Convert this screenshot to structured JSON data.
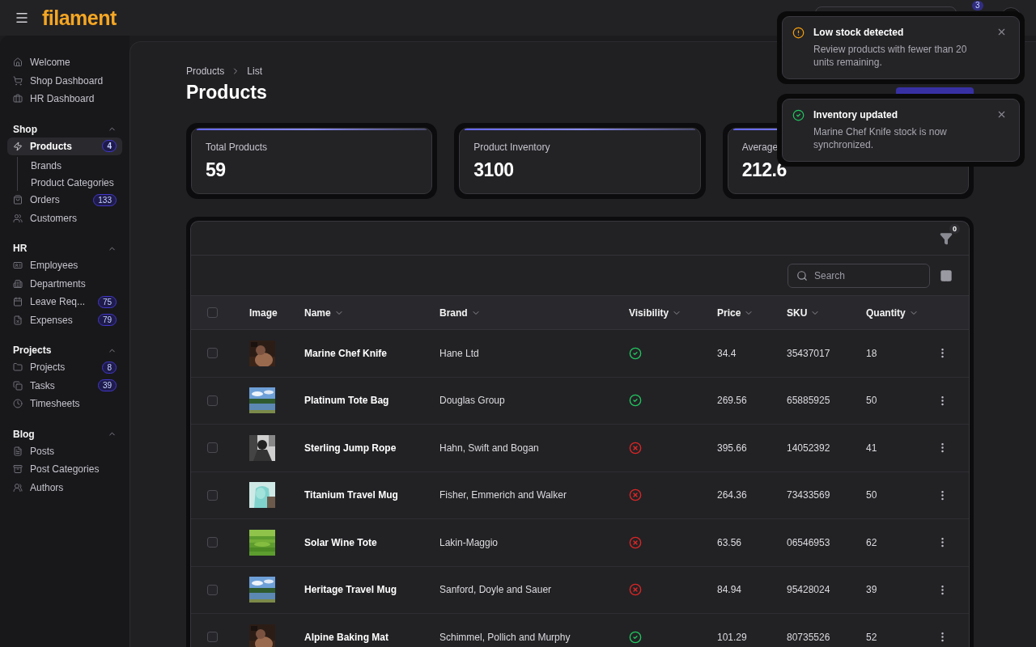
{
  "topbar": {
    "brand": "filament",
    "notification_count": "3"
  },
  "sidebar": {
    "groups": [
      {
        "items": [
          {
            "label": "Welcome",
            "selected": false
          },
          {
            "label": "Shop Dashboard",
            "selected": false
          },
          {
            "label": "HR Dashboard",
            "selected": false
          }
        ]
      },
      {
        "label": "Shop",
        "expanded": true,
        "items": [
          {
            "label": "Products",
            "selected": true,
            "badge": "4",
            "children": [
              {
                "label": "Brands",
                "selected": false
              },
              {
                "label": "Product Categories",
                "selected": false
              }
            ]
          },
          {
            "label": "Orders",
            "selected": false,
            "badge": "133"
          },
          {
            "label": "Customers",
            "selected": false
          }
        ]
      },
      {
        "label": "HR",
        "expanded": true,
        "items": [
          {
            "label": "Employees",
            "selected": false
          },
          {
            "label": "Departments",
            "selected": false
          },
          {
            "label": "Leave Req...",
            "selected": false,
            "badge": "75"
          },
          {
            "label": "Expenses",
            "selected": false,
            "badge": "79"
          }
        ]
      },
      {
        "label": "Projects",
        "expanded": true,
        "items": [
          {
            "label": "Projects",
            "selected": false,
            "badge": "8"
          },
          {
            "label": "Tasks",
            "selected": false,
            "badge": "39"
          },
          {
            "label": "Timesheets",
            "selected": false
          }
        ]
      },
      {
        "label": "Blog",
        "expanded": true,
        "items": [
          {
            "label": "Posts",
            "selected": false
          },
          {
            "label": "Post Categories",
            "selected": false
          },
          {
            "label": "Authors",
            "selected": false
          }
        ]
      }
    ]
  },
  "breadcrumbs": [
    "Products",
    "List"
  ],
  "title": "Products",
  "stats": [
    {
      "label": "Total Products",
      "value": "59"
    },
    {
      "label": "Product Inventory",
      "value": "3100"
    },
    {
      "label": "Average",
      "value": "212.6"
    }
  ],
  "table": {
    "filter_count": "0",
    "select_all_checked": false,
    "search": {
      "placeholder": "Search"
    },
    "columns": [
      {
        "label": "Image",
        "sortable": false
      },
      {
        "label": "Name",
        "sortable": true
      },
      {
        "label": "Brand",
        "sortable": true
      },
      {
        "label": "Visibility",
        "sortable": true
      },
      {
        "label": "Price",
        "sortable": true
      },
      {
        "label": "SKU",
        "sortable": true
      },
      {
        "label": "Quantity",
        "sortable": true
      }
    ],
    "rows": [
      {
        "checked": false,
        "name": "Marine Chef Knife",
        "brand": "Hane Ltd",
        "visible": true,
        "price": "34.4",
        "sku": "35437017",
        "quantity": "18"
      },
      {
        "checked": false,
        "name": "Platinum Tote Bag",
        "brand": "Douglas Group",
        "visible": true,
        "price": "269.56",
        "sku": "65885925",
        "quantity": "50"
      },
      {
        "checked": false,
        "name": "Sterling Jump Rope",
        "brand": "Hahn, Swift and Bogan",
        "visible": false,
        "price": "395.66",
        "sku": "14052392",
        "quantity": "41"
      },
      {
        "checked": false,
        "name": "Titanium Travel Mug",
        "brand": "Fisher, Emmerich and Walker",
        "visible": false,
        "price": "264.36",
        "sku": "73433569",
        "quantity": "50"
      },
      {
        "checked": false,
        "name": "Solar Wine Tote",
        "brand": "Lakin-Maggio",
        "visible": false,
        "price": "63.56",
        "sku": "06546953",
        "quantity": "62"
      },
      {
        "checked": false,
        "name": "Heritage Travel Mug",
        "brand": "Sanford, Doyle and Sauer",
        "visible": false,
        "price": "84.94",
        "sku": "95428024",
        "quantity": "39"
      },
      {
        "checked": false,
        "name": "Alpine Baking Mat",
        "brand": "Schimmel, Pollich and Murphy",
        "visible": true,
        "price": "101.29",
        "sku": "80735526",
        "quantity": "52"
      }
    ]
  },
  "notifications": [
    {
      "kind": "warning",
      "title": "Low stock detected",
      "body": "Review products with fewer than 20 units remaining."
    },
    {
      "kind": "success",
      "title": "Inventory updated",
      "body": "Marine Chef Knife stock is now synchronized."
    }
  ]
}
